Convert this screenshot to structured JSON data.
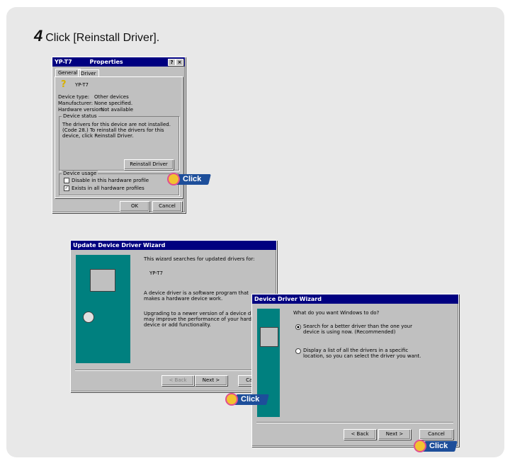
{
  "step": {
    "number": "4",
    "text": "Click [Reinstall Driver]."
  },
  "properties": {
    "title_left": "YP-T7",
    "title_right": "Properties",
    "help": "?",
    "close": "×",
    "tabs": [
      "General",
      "Driver"
    ],
    "device_name": "YP-T7",
    "rows": [
      {
        "label": "Device type:",
        "value": "Other devices"
      },
      {
        "label": "Manufacturer:",
        "value": "None specified."
      },
      {
        "label": "Hardware version:",
        "value": "Not available"
      }
    ],
    "status_group": "Device status",
    "status_text": "The drivers for this device are not installed. (Code 28.) To reinstall the drivers for this device, click Reinstall Driver.",
    "reinstall": "Reinstall Driver",
    "usage_group": "Device usage",
    "usage_items": [
      "Disable in this hardware profile",
      "Exists in all hardware profiles"
    ],
    "ok": "OK",
    "cancel": "Cancel"
  },
  "wizard1": {
    "title": "Update Device Driver Wizard",
    "intro": "This wizard searches for updated drivers for:",
    "device": "YP-T7",
    "desc1": "A device driver is a software program that makes a hardware device work.",
    "desc2": "Upgrading to a newer version of a device driver may improve the performance of your hardware device or add functionality.",
    "back": "< Back",
    "next": "Next >",
    "cancel": "Cancel"
  },
  "wizard2": {
    "title": "Device Driver Wizard",
    "question": "What do you want Windows to do?",
    "option1": "Search for a better driver than the one your device is using now. (Recommended)",
    "option2": "Display a list of all the drivers in a specific location, so you can select the driver you want.",
    "back": "< Back",
    "next": "Next >",
    "cancel": "Cancel"
  },
  "click_label": "Click",
  "colors": {
    "panel": "#e8e8e8",
    "titlebar": "#000080",
    "click_tag": "#1d4e9a",
    "art": "#00807f"
  }
}
